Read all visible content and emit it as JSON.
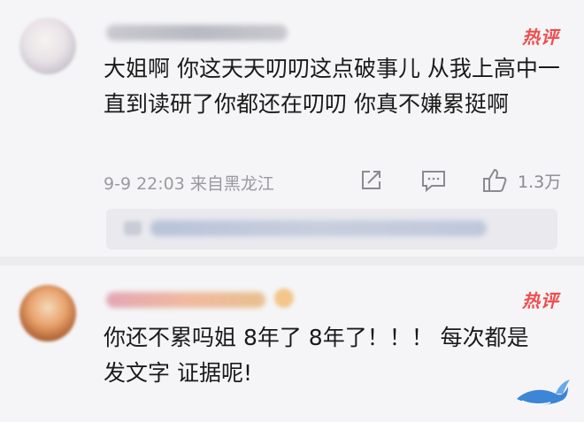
{
  "comments": [
    {
      "hot_label": "热评",
      "text": "大姐啊 你这天天叨叨这点破事儿 从我上高中一直到读研了你都还在叨叨 你真不嫌累挺啊",
      "meta": "9-9 22:03 来自黑龙江",
      "like_count": "1.3万"
    },
    {
      "hot_label": "热评",
      "text": "你还不累吗姐 8年了 8年了！！！ 每次都是发文字 证据呢!"
    }
  ],
  "colors": {
    "hot_red": "#ef4d4d",
    "meta_grey": "#9a9a9f",
    "text_dark": "#1a1a1a",
    "background": "#f5f5f7"
  },
  "icons": [
    "share-icon",
    "comment-icon",
    "like-icon",
    "whale-watermark-icon"
  ]
}
